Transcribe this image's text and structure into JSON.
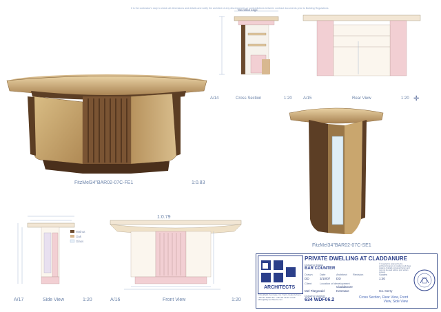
{
  "header_note": "It is the contractor's duty to check all dimensions and details and notify the architect of any discrepancies or contradictions between contract documents prior to Building Regulations",
  "views": {
    "perspective_front": {
      "caption": "FitzMel34\"BAR02-07C-FE1",
      "scale": "1:0.83"
    },
    "perspective_side": {
      "caption": "FitzMel34\"BAR02-07C-SE1"
    },
    "cross_section": {
      "ref": "A/14",
      "title": "Cross Section",
      "scale": "1:20",
      "annotation": "Bevelled edge"
    },
    "rear_view": {
      "ref": "A/15",
      "title": "Rear View",
      "scale": "1:20"
    },
    "side_view": {
      "ref": "A/17",
      "title": "Side View",
      "scale": "1:20",
      "legend": [
        "Walnut",
        "Oak",
        "Glass"
      ]
    },
    "front_view": {
      "ref": "A/16",
      "title": "Front View",
      "scale": "1:20",
      "scale_note": "1:0.79"
    }
  },
  "title_block": {
    "project": "PRIVATE DWELLING AT CLADDANURE",
    "drawing_status_label": "Drawing Status",
    "drawing_title": "BAR COUNTER",
    "drawn_label": "Drawn",
    "date_label": "Date",
    "architect_label": "Architect",
    "revision_label": "Revision",
    "scales_label": "Scales",
    "drawn_value": "DD",
    "date_value": "3/10/07",
    "architect_value": "DD",
    "scale_value": "1:20",
    "client_label": "Client",
    "location_label": "Location of development",
    "client_value": "Mel Fitzgerald",
    "location_value": "Claddanure",
    "location_value_2": "Kenmare",
    "county_value": "Co. Kerry",
    "drawing_number_label": "Drawing Number",
    "drawing_number": "634 WDF06.2",
    "sheet_contents": "Cross Section, Rear View, Front View, Side View",
    "logo_text": "ARCHITECTS",
    "copyright": "© Copyright is retained by the architect/company in relation to all ideas designs & details contained herein and may not be used without prior written consent",
    "firm_address": "3 Rockfield, Kenmare, Co. Kerry, Ireland  phone: +353 64 41196  fax: +353 64 41197  email: office@daly-architects.com"
  },
  "colors": {
    "ink": "#4a5f92",
    "timber_light": "#c9a66e",
    "timber_dark": "#6b4a2e",
    "pink_fill": "#f2cfd3"
  }
}
